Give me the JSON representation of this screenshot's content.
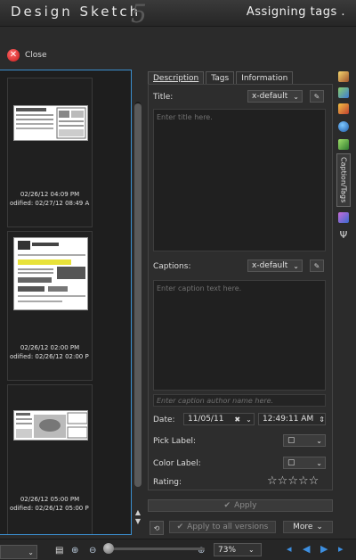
{
  "app": {
    "title_text": "Design Sketch",
    "version_mark": "5",
    "header_right": "Assigning tags ."
  },
  "close": {
    "label": "Close"
  },
  "thumbnails": [
    {
      "date": "02/26/12 04:09 PM",
      "modified": "odified: 02/27/12 08:49 A"
    },
    {
      "date": "02/26/12 02:00 PM",
      "modified": "odified: 02/26/12 02:00 P"
    },
    {
      "date": "02/26/12 05:00 PM",
      "modified": "odified: 02/26/12 05:00 P"
    }
  ],
  "tabs": [
    {
      "label": "Description",
      "active": true
    },
    {
      "label": "Tags",
      "active": false
    },
    {
      "label": "Information",
      "active": false
    }
  ],
  "description": {
    "title_label": "Title:",
    "title_lang": "x-default",
    "title_placeholder": "Enter title here.",
    "captions_label": "Captions:",
    "captions_lang": "x-default",
    "caption_placeholder": "Enter caption text here.",
    "author_placeholder": "Enter caption author name here.",
    "date_label": "Date:",
    "date_value": "11/05/11",
    "time_value": "12:49:11 AM",
    "pick_label": "Pick Label:",
    "color_label": "Color Label:",
    "rating_label": "Rating:",
    "rating_value": 0,
    "rating_max": 5
  },
  "buttons": {
    "apply": "Apply",
    "apply_all": "Apply to all versions",
    "more": "More"
  },
  "side_panel": {
    "caption_tags": "Caption/Tags"
  },
  "statusbar": {
    "zoom": "73%"
  },
  "icons": {
    "close": "close-icon",
    "edit": "pencil-icon",
    "star": "star-icon"
  }
}
